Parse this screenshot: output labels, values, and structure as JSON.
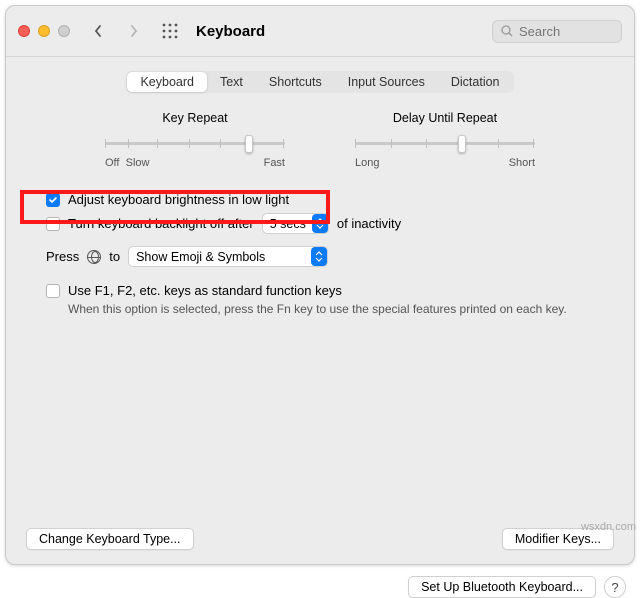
{
  "header": {
    "title": "Keyboard",
    "search_placeholder": "Search"
  },
  "tabs": [
    "Keyboard",
    "Text",
    "Shortcuts",
    "Input Sources",
    "Dictation"
  ],
  "keyRepeat": {
    "label": "Key Repeat",
    "left": "Off",
    "left2": "Slow",
    "right": "Fast"
  },
  "delayRepeat": {
    "label": "Delay Until Repeat",
    "left": "Long",
    "right": "Short"
  },
  "opts": {
    "adjust": "Adjust keyboard brightness in low light",
    "backlight_pre": "Turn keyboard backlight off after",
    "backlight_val": "5 secs",
    "backlight_post": "of inactivity",
    "press": "Press",
    "to": "to",
    "emoji_val": "Show Emoji & Symbols",
    "fn": "Use F1, F2, etc. keys as standard function keys",
    "fn_help": "When this option is selected, press the Fn key to use the special features printed on each key."
  },
  "buttons": {
    "changeType": "Change Keyboard Type...",
    "modifier": "Modifier Keys...",
    "bluetooth": "Set Up Bluetooth Keyboard...",
    "help": "?"
  },
  "watermark": "wsxdn.com"
}
